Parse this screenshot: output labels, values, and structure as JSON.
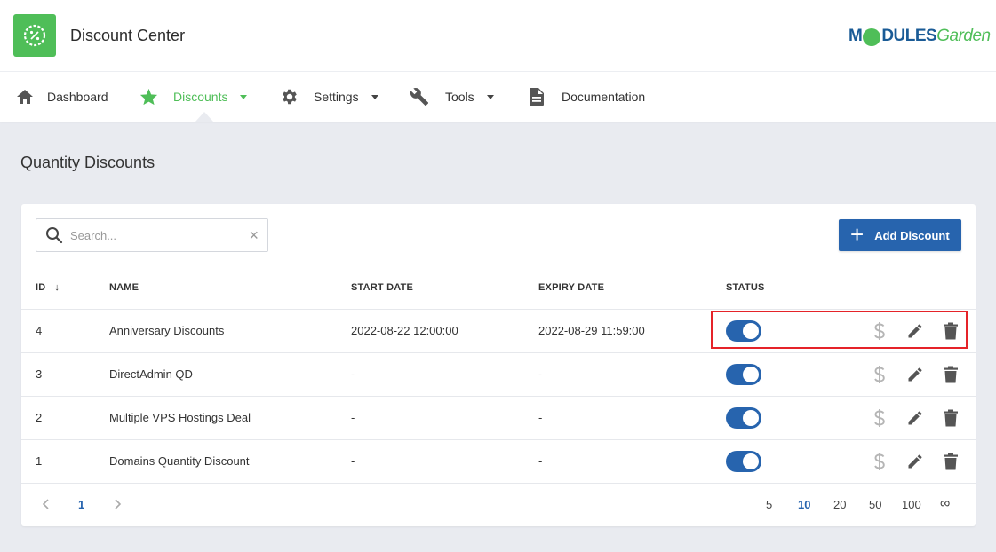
{
  "app": {
    "title": "Discount Center",
    "brand_m": "M",
    "brand_dules": "DULES",
    "brand_garden": "Garden"
  },
  "nav": {
    "items": [
      {
        "label": "Dashboard",
        "icon": "home-icon"
      },
      {
        "label": "Discounts",
        "icon": "star-icon",
        "active": true
      },
      {
        "label": "Settings",
        "icon": "gear-icon"
      },
      {
        "label": "Tools",
        "icon": "wrench-icon"
      },
      {
        "label": "Documentation",
        "icon": "document-icon"
      }
    ]
  },
  "page": {
    "title": "Quantity Discounts"
  },
  "search": {
    "placeholder": "Search...",
    "value": ""
  },
  "toolbar": {
    "add_label": "Add Discount"
  },
  "table": {
    "headers": {
      "id": "ID",
      "name": "NAME",
      "start": "START DATE",
      "expiry": "EXPIRY DATE",
      "status": "STATUS"
    },
    "sort_arrow": "↓",
    "rows": [
      {
        "id": "4",
        "name": "Anniversary Discounts",
        "start": "2022-08-22 12:00:00",
        "expiry": "2022-08-29 11:59:00",
        "status": true
      },
      {
        "id": "3",
        "name": "DirectAdmin QD",
        "start": "-",
        "expiry": "-",
        "status": true
      },
      {
        "id": "2",
        "name": "Multiple VPS Hostings Deal",
        "start": "-",
        "expiry": "-",
        "status": true
      },
      {
        "id": "1",
        "name": "Domains Quantity Discount",
        "start": "-",
        "expiry": "-",
        "status": true
      }
    ]
  },
  "pagination": {
    "current_page": "1",
    "page_sizes": [
      "5",
      "10",
      "20",
      "50",
      "100",
      "∞"
    ],
    "active_size": "10"
  },
  "colors": {
    "accent": "#4fbe58",
    "primary": "#2764ae",
    "highlight": "#e52329"
  }
}
